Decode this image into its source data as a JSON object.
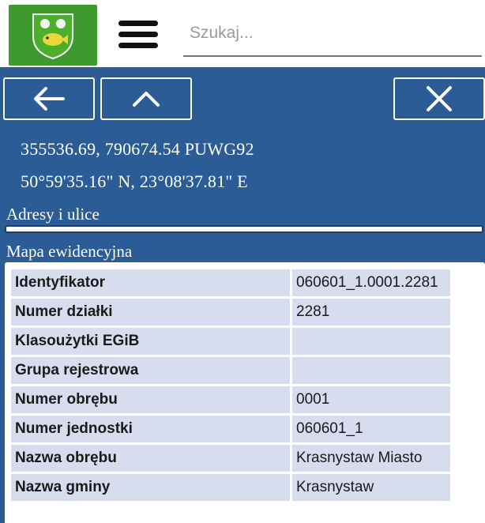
{
  "search": {
    "placeholder": "Szukaj..."
  },
  "coordinates": {
    "puwg": "355536.69, 790674.54 PUWG92",
    "geo": "50°59'35.16\" N, 23°08'37.81\" E"
  },
  "sections": {
    "addresses": "Adresy i ulice",
    "map": "Mapa ewidencyjna"
  },
  "parcel_table": [
    {
      "label": "Identyfikator",
      "value": "060601_1.0001.2281"
    },
    {
      "label": "Numer działki",
      "value": "2281"
    },
    {
      "label": "Klasoużytki EGiB",
      "value": ""
    },
    {
      "label": "Grupa rejestrowa",
      "value": ""
    },
    {
      "label": "Numer obrębu",
      "value": "0001"
    },
    {
      "label": "Numer jednostki",
      "value": "060601_1"
    },
    {
      "label": "Nazwa obrębu",
      "value": "Krasnystaw Miasto"
    },
    {
      "label": "Nazwa gminy",
      "value": "Krasnystaw"
    }
  ],
  "colors": {
    "primary": "#2c5c96",
    "logo_bg": "#3e9a2f",
    "cell_bg": "#d8dcef"
  },
  "icons": {
    "logo": "coat-of-arms-icon",
    "menu": "hamburger-icon",
    "back": "arrow-left-icon",
    "up": "chevron-up-icon",
    "close": "close-icon"
  }
}
